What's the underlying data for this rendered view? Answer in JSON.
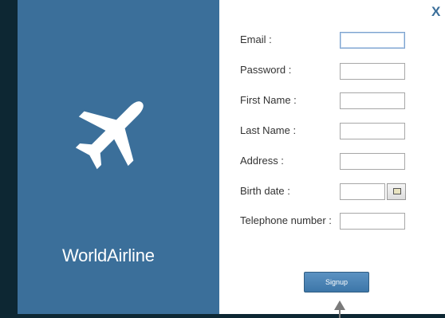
{
  "window": {
    "close_label": "X"
  },
  "brand": {
    "name": "WorldAirline",
    "icon": "airplane-icon"
  },
  "form": {
    "email_label": "Email :",
    "email_value": "",
    "password_label": "Password :",
    "password_value": "",
    "first_name_label": "First Name :",
    "first_name_value": "",
    "last_name_label": "Last Name :",
    "last_name_value": "",
    "address_label": "Address :",
    "address_value": "",
    "birth_date_label": "Birth date :",
    "birth_date_value": "",
    "telephone_label": "Telephone number :",
    "telephone_value": "",
    "signup_label": "Signup"
  },
  "colors": {
    "brand_panel": "#3b6f9a",
    "background": "#0d2733",
    "button": "#4a84b6"
  }
}
